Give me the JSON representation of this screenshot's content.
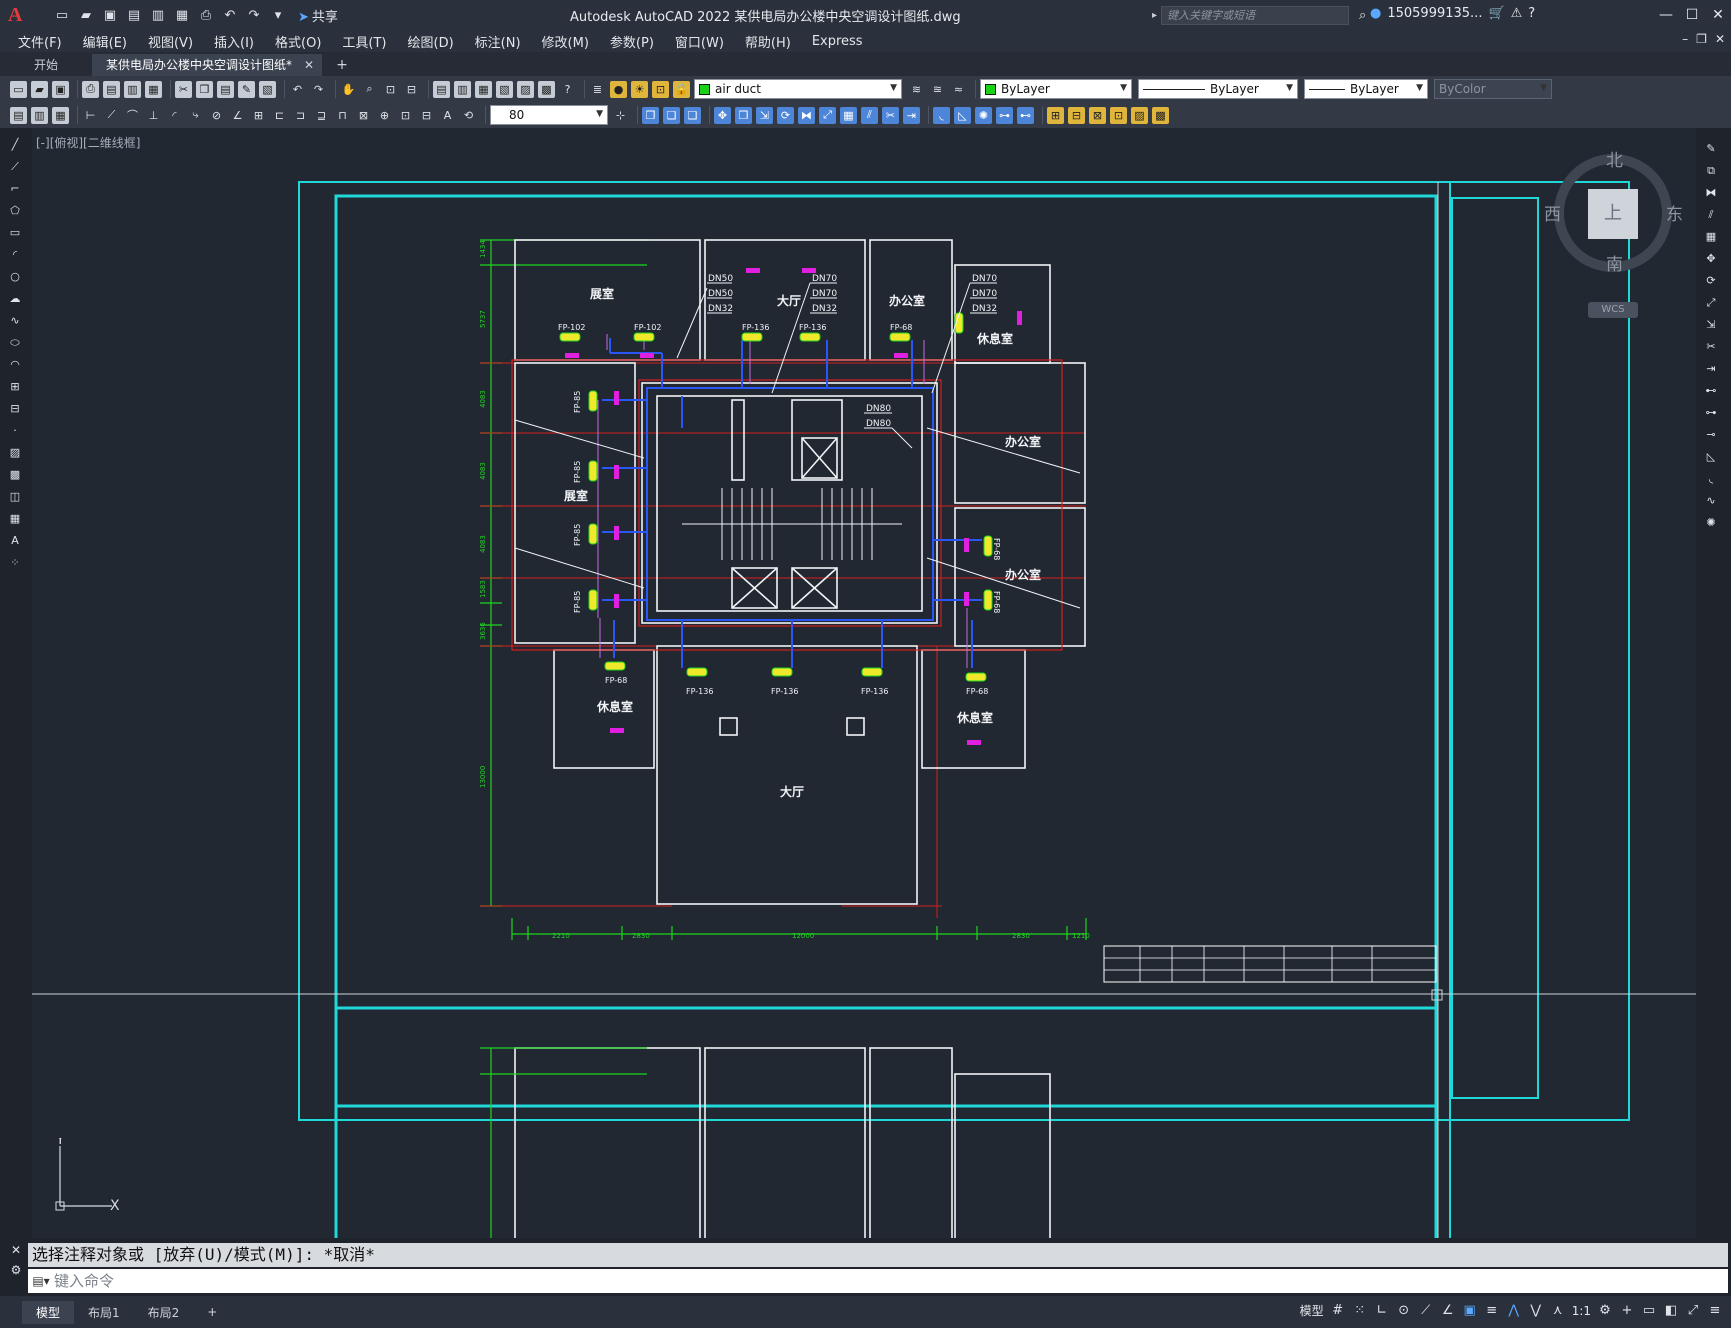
{
  "app": {
    "title": "Autodesk AutoCAD 2022    某供电局办公楼中央空调设计图纸.dwg",
    "share_label": "共享",
    "search_placeholder": "键入关键字或短语",
    "user_name": "1505999135...",
    "logo": "A"
  },
  "menu": [
    "文件(F)",
    "编辑(E)",
    "视图(V)",
    "插入(I)",
    "格式(O)",
    "工具(T)",
    "绘图(D)",
    "标注(N)",
    "修改(M)",
    "参数(P)",
    "窗口(W)",
    "帮助(H)",
    "Express"
  ],
  "tabs": {
    "start": "开始",
    "active": "某供电局办公楼中央空调设计图纸*"
  },
  "toolbar": {
    "layer_name": "air duct",
    "color_value": "ByLayer",
    "linetype_value": "ByLayer",
    "lineweight_value": "ByLayer",
    "plotstyle_value": "ByColor",
    "dim_value": "80",
    "layer_color": "#19d219"
  },
  "viewport": {
    "label": "[-][俯视][二维线框]"
  },
  "viewcube": {
    "north": "北",
    "south": "南",
    "east": "东",
    "west": "西",
    "top": "上",
    "wcs": "WCS"
  },
  "drawing": {
    "rooms": {
      "exhibit1": "展室",
      "hall_top": "大厅",
      "office_top": "办公室",
      "rest_top": "休息室",
      "office_right1": "办公室",
      "office_right2": "办公室",
      "exhibit2": "展室",
      "rest_left": "休息室",
      "rest_right": "休息室",
      "hall_bottom": "大厅"
    },
    "fan_coils": {
      "fp102a": "FP-102",
      "fp102b": "FP-102",
      "fp136a": "FP-136",
      "fp136b": "FP-136",
      "fp68a": "FP-68",
      "fp85a": "FP-85",
      "fp85b": "FP-85",
      "fp85c": "FP-85",
      "fp85d": "FP-85",
      "fp68b": "FP-68",
      "fp68c": "FP-68",
      "fp68d": "FP-68",
      "fp68e": "FP-68",
      "fp136c": "FP-136",
      "fp136d": "FP-136",
      "fp136e": "FP-136"
    },
    "pipes": {
      "dn50a": "DN50",
      "dn50b": "DN50",
      "dn32a": "DN32",
      "dn70a": "DN70",
      "dn70b": "DN70",
      "dn32b": "DN32",
      "dn70c": "DN70",
      "dn70d": "DN70",
      "dn32c": "DN32",
      "dn80a": "DN80",
      "dn80b": "DN80"
    }
  },
  "command": {
    "history": "选择注释对象或 [放弃(U)/模式(M)]: *取消*",
    "placeholder": "键入命令"
  },
  "status": {
    "layouts": [
      "模型",
      "布局1",
      "布局2"
    ],
    "model_label": "模型",
    "scale": "1:1"
  }
}
